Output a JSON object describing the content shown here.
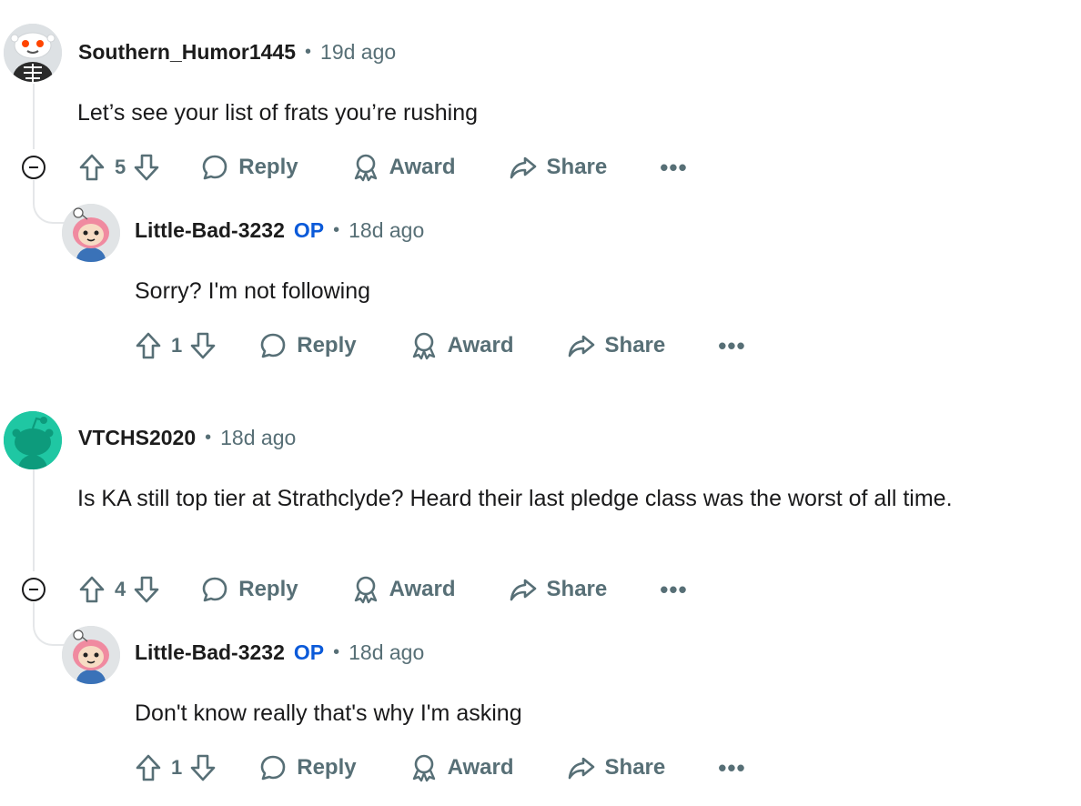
{
  "comments": [
    {
      "username": "Southern_Humor1445",
      "time": "19d ago",
      "text": "Let’s see your list of frats you’re rushing",
      "votes": "5",
      "actions": {
        "reply": "Reply",
        "award": "Award",
        "share": "Share",
        "more": "•••"
      },
      "reply": {
        "username": "Little-Bad-3232",
        "flair": "OP",
        "time": "18d ago",
        "text": "Sorry? I'm not following",
        "votes": "1",
        "actions": {
          "reply": "Reply",
          "award": "Award",
          "share": "Share",
          "more": "•••"
        }
      }
    },
    {
      "username": "VTCHS2020",
      "time": "18d ago",
      "text": "Is KA still top tier at Strathclyde? Heard their last pledge class was the worst of all time.",
      "votes": "4",
      "actions": {
        "reply": "Reply",
        "award": "Award",
        "share": "Share",
        "more": "•••"
      },
      "reply": {
        "username": "Little-Bad-3232",
        "flair": "OP",
        "time": "18d ago",
        "text": "Don't know really that's why I'm asking",
        "votes": "1",
        "actions": {
          "reply": "Reply",
          "award": "Award",
          "share": "Share",
          "more": "•••"
        }
      }
    }
  ],
  "colors": {
    "op": "#0b5ad9",
    "meta": "#576f76",
    "avatar_green": "#1fc7a3",
    "thread_line": "#e5e7e9"
  }
}
